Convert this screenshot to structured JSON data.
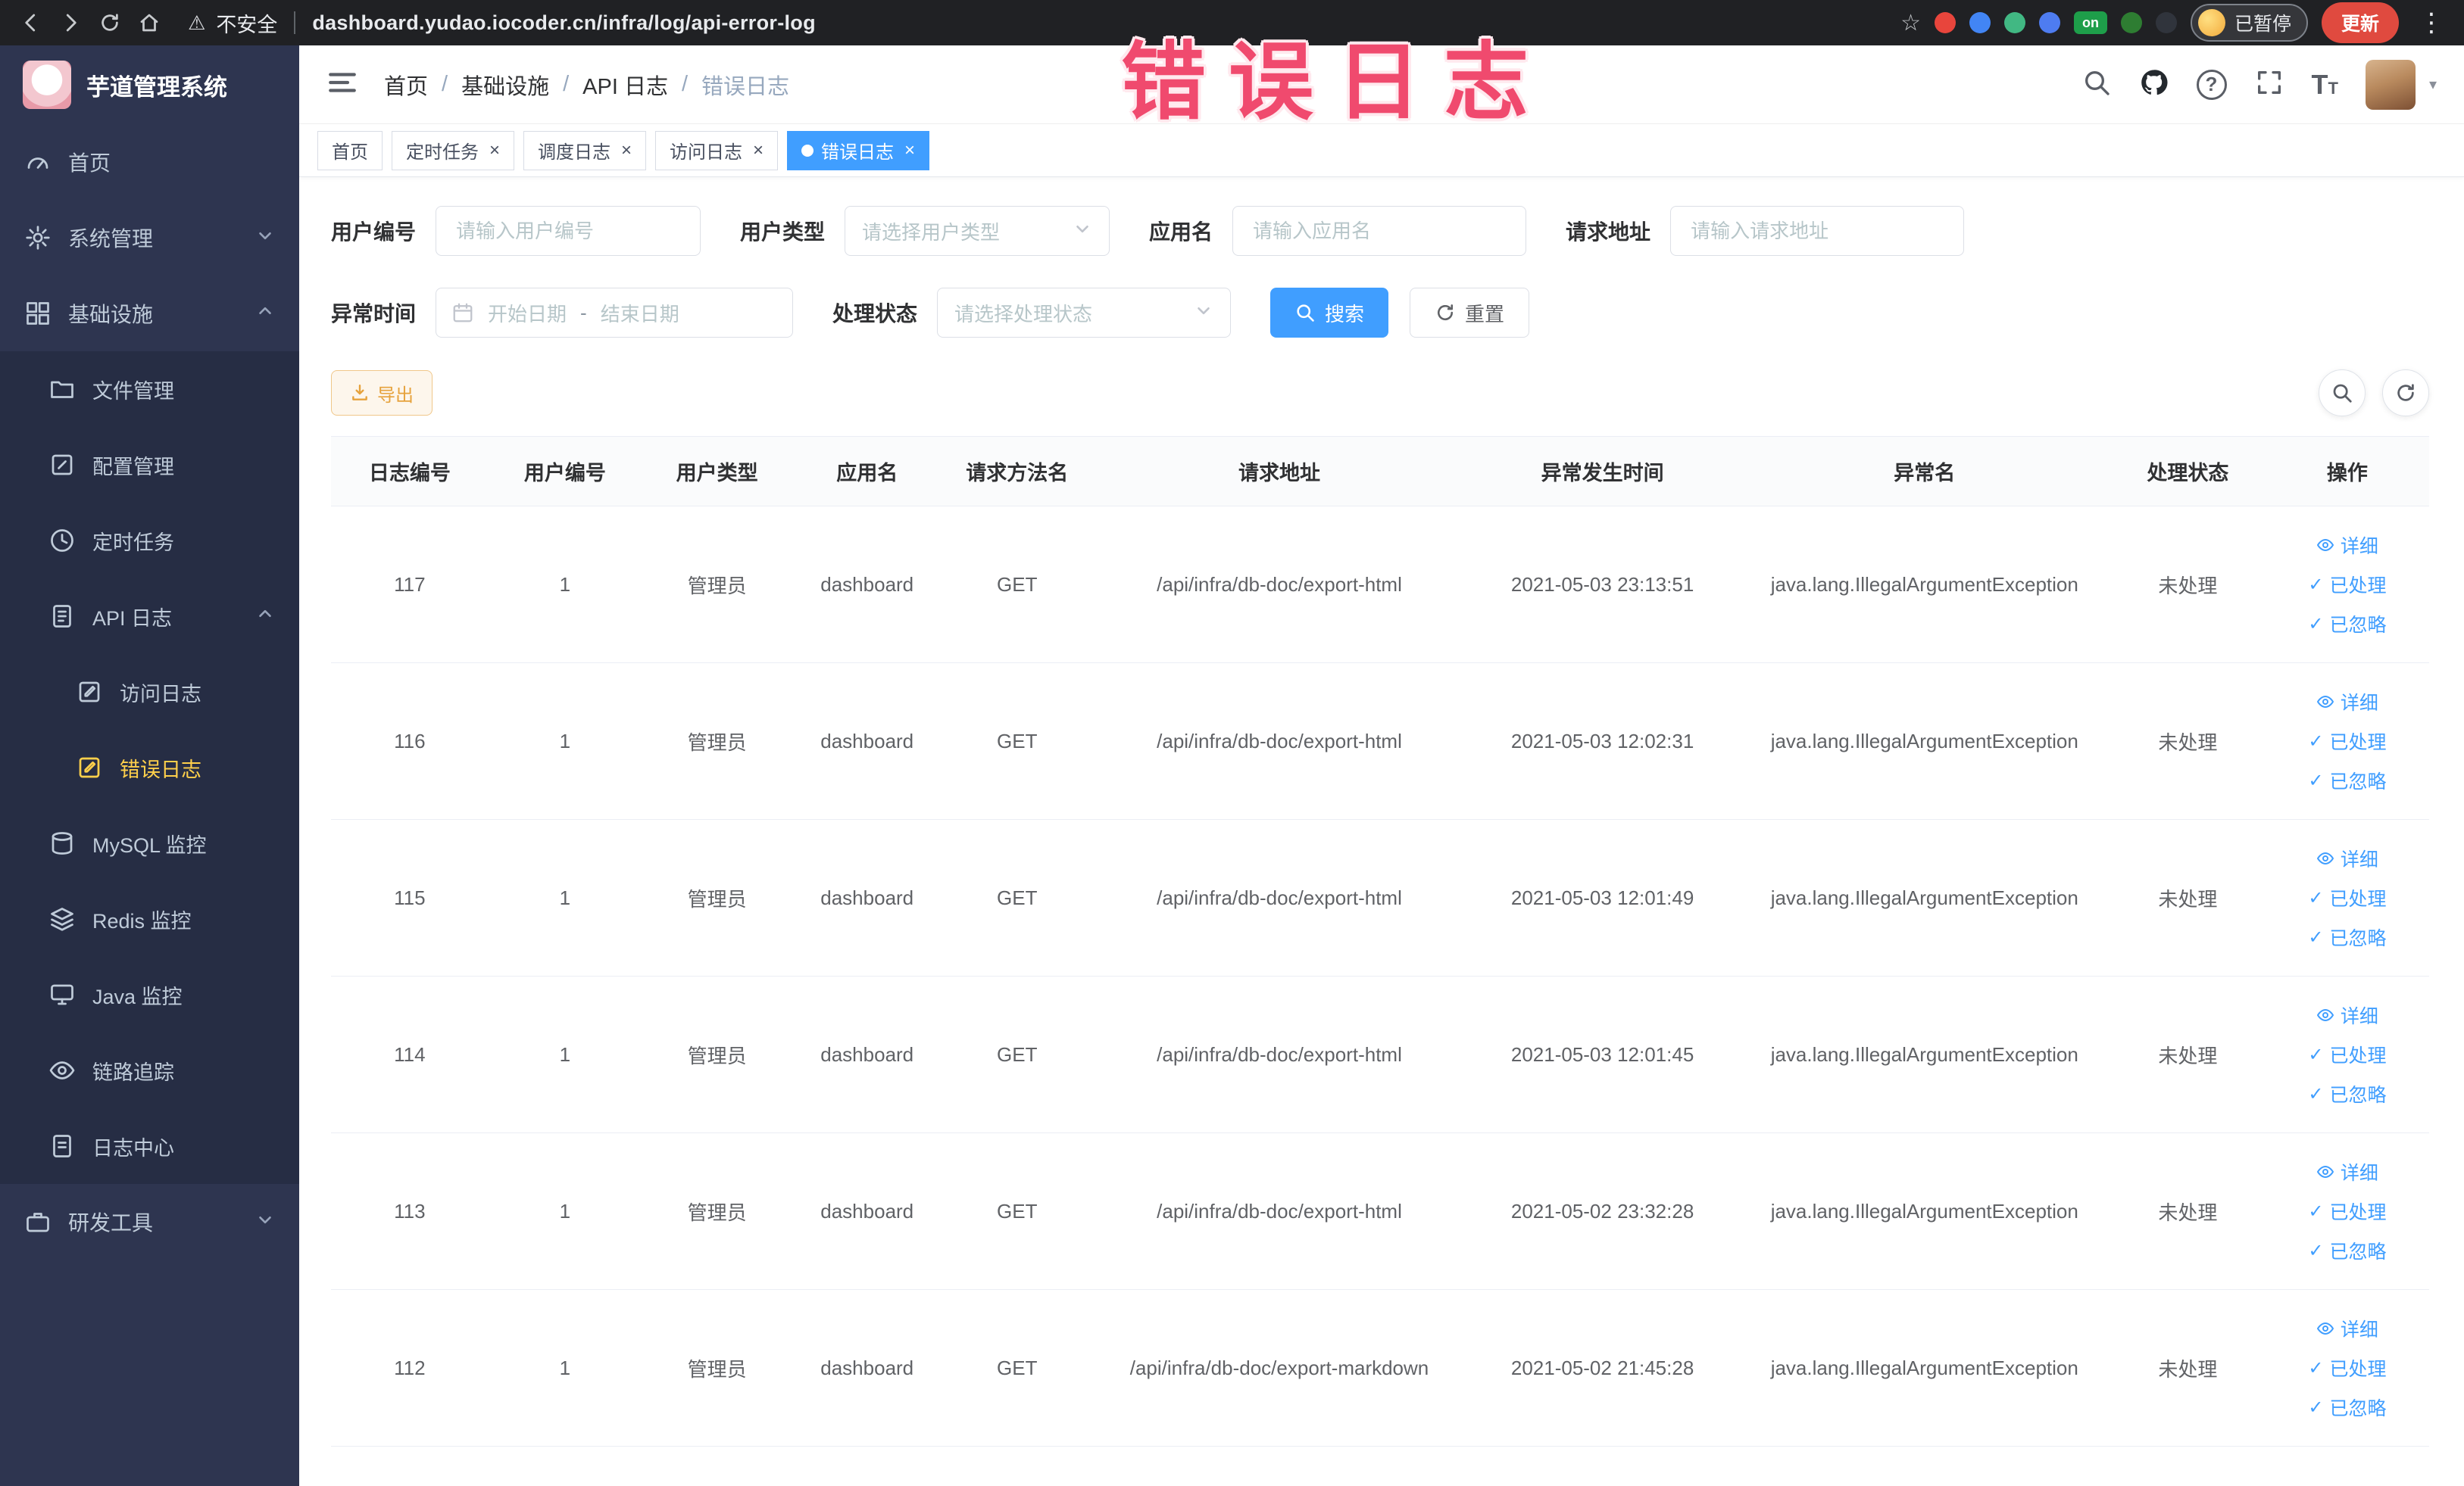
{
  "browser": {
    "security_label": "不安全",
    "url": "dashboard.yudao.iocoder.cn/infra/log/api-error-log",
    "extension_on_badge": "on",
    "paused_badge": "已暂停",
    "update_label": "更新"
  },
  "overlay_caption": "错误日志",
  "sidebar": {
    "logo_title": "芋道管理系统",
    "home": "首页",
    "system": "系统管理",
    "infra": "基础设施",
    "file": "文件管理",
    "config": "配置管理",
    "job": "定时任务",
    "api_log": "API 日志",
    "access_log": "访问日志",
    "error_log": "错误日志",
    "mysql": "MySQL 监控",
    "redis": "Redis 监控",
    "java": "Java 监控",
    "trace": "链路追踪",
    "log_center": "日志中心",
    "devtools": "研发工具"
  },
  "breadcrumb": {
    "separator": "/",
    "items": [
      "首页",
      "基础设施",
      "API 日志",
      "错误日志"
    ]
  },
  "tabs": [
    {
      "label": "首页"
    },
    {
      "label": "定时任务"
    },
    {
      "label": "调度日志"
    },
    {
      "label": "访问日志"
    },
    {
      "label": "错误日志"
    }
  ],
  "filters": {
    "user_id_label": "用户编号",
    "user_id_placeholder": "请输入用户编号",
    "user_type_label": "用户类型",
    "user_type_placeholder": "请选择用户类型",
    "app_name_label": "应用名",
    "app_name_placeholder": "请输入应用名",
    "request_url_label": "请求地址",
    "request_url_placeholder": "请输入请求地址",
    "exception_time_label": "异常时间",
    "date_start_placeholder": "开始日期",
    "date_separator": "-",
    "date_end_placeholder": "结束日期",
    "process_status_label": "处理状态",
    "process_status_placeholder": "请选择处理状态",
    "search_button": "搜索",
    "reset_button": "重置"
  },
  "toolbar": {
    "export_button": "导出"
  },
  "table": {
    "columns": [
      "日志编号",
      "用户编号",
      "用户类型",
      "应用名",
      "请求方法名",
      "请求地址",
      "异常发生时间",
      "异常名",
      "处理状态",
      "操作"
    ],
    "actions": {
      "detail": "详细",
      "processed": "已处理",
      "ignored": "已忽略"
    },
    "rows": [
      {
        "id": "117",
        "user_id": "1",
        "user_type": "管理员",
        "app": "dashboard",
        "method": "GET",
        "url": "/api/infra/db-doc/export-html",
        "time": "2021-05-03 23:13:51",
        "exception": "java.lang.IllegalArgumentException",
        "status": "未处理"
      },
      {
        "id": "116",
        "user_id": "1",
        "user_type": "管理员",
        "app": "dashboard",
        "method": "GET",
        "url": "/api/infra/db-doc/export-html",
        "time": "2021-05-03 12:02:31",
        "exception": "java.lang.IllegalArgumentException",
        "status": "未处理"
      },
      {
        "id": "115",
        "user_id": "1",
        "user_type": "管理员",
        "app": "dashboard",
        "method": "GET",
        "url": "/api/infra/db-doc/export-html",
        "time": "2021-05-03 12:01:49",
        "exception": "java.lang.IllegalArgumentException",
        "status": "未处理"
      },
      {
        "id": "114",
        "user_id": "1",
        "user_type": "管理员",
        "app": "dashboard",
        "method": "GET",
        "url": "/api/infra/db-doc/export-html",
        "time": "2021-05-03 12:01:45",
        "exception": "java.lang.IllegalArgumentException",
        "status": "未处理"
      },
      {
        "id": "113",
        "user_id": "1",
        "user_type": "管理员",
        "app": "dashboard",
        "method": "GET",
        "url": "/api/infra/db-doc/export-html",
        "time": "2021-05-02 23:32:28",
        "exception": "java.lang.IllegalArgumentException",
        "status": "未处理"
      },
      {
        "id": "112",
        "user_id": "1",
        "user_type": "管理员",
        "app": "dashboard",
        "method": "GET",
        "url": "/api/infra/db-doc/export-markdown",
        "time": "2021-05-02 21:45:28",
        "exception": "java.lang.IllegalArgumentException",
        "status": "未处理"
      }
    ]
  }
}
